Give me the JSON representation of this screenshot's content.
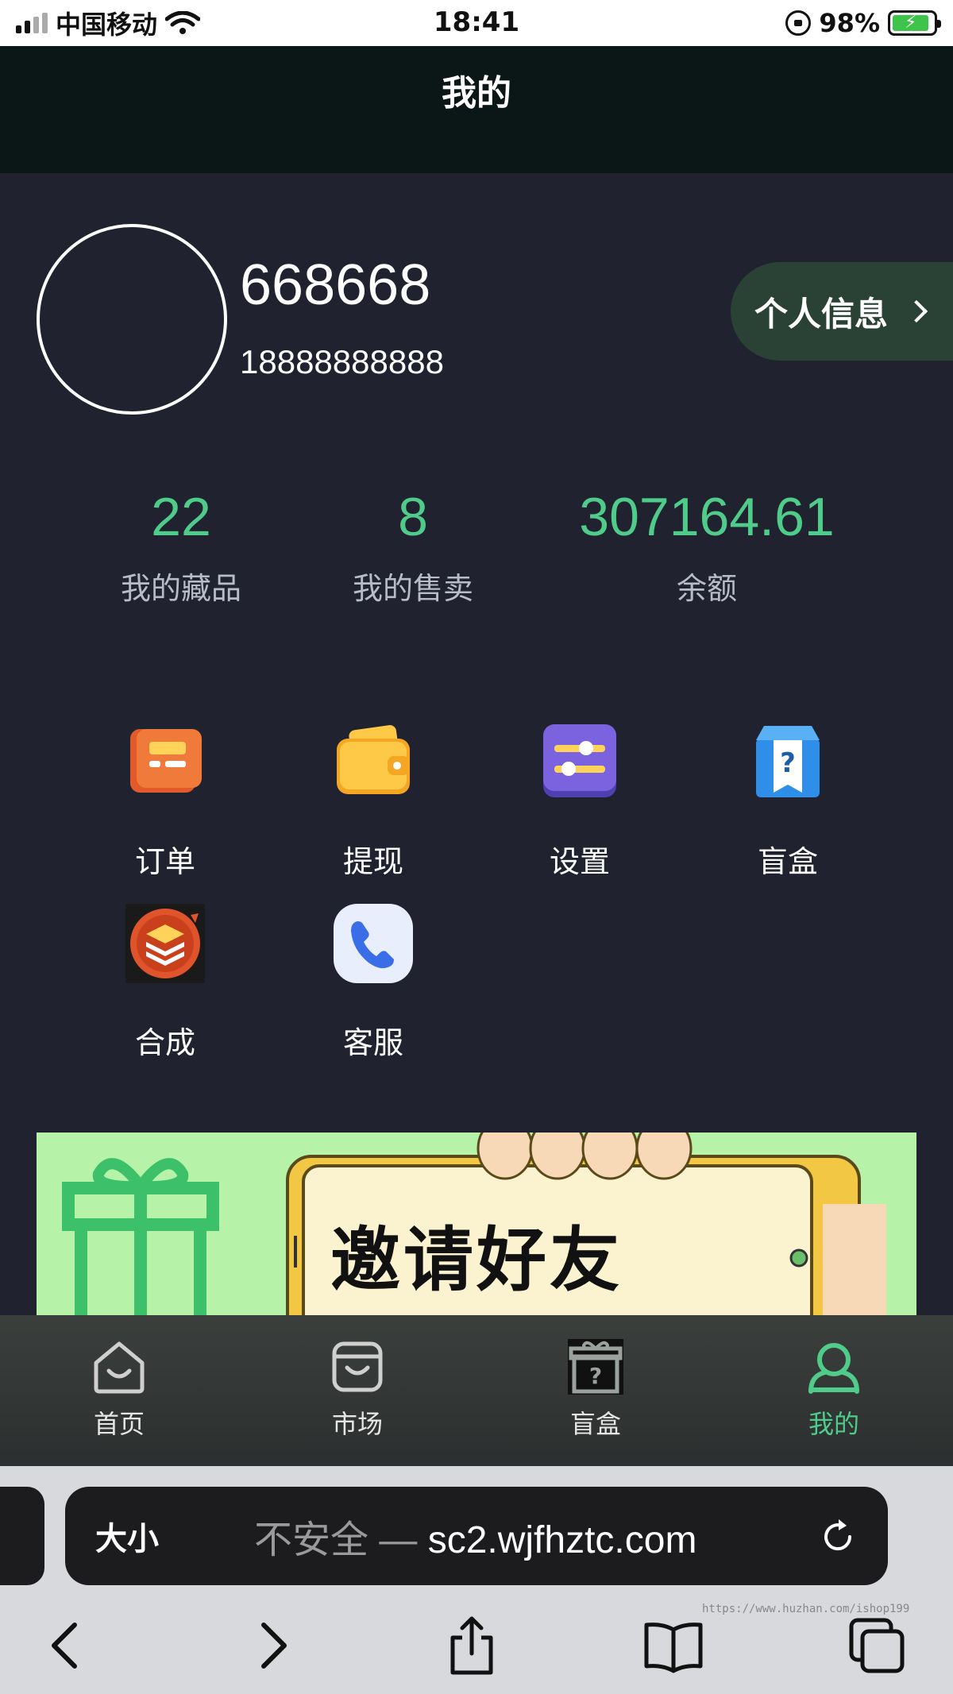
{
  "status_bar": {
    "carrier": "中国移动",
    "time": "18:41",
    "battery_percent": "98%"
  },
  "header": {
    "title": "我的"
  },
  "profile": {
    "username": "668668",
    "phone": "18888888888",
    "info_button_label": "个人信息"
  },
  "stats": [
    {
      "value": "22",
      "label": "我的藏品"
    },
    {
      "value": "8",
      "label": "我的售卖"
    },
    {
      "value": "307164.61",
      "label": "余额"
    }
  ],
  "menu": [
    {
      "label": "订单",
      "icon": "order-icon"
    },
    {
      "label": "提现",
      "icon": "wallet-icon"
    },
    {
      "label": "设置",
      "icon": "settings-icon"
    },
    {
      "label": "盲盒",
      "icon": "blind-box-icon"
    },
    {
      "label": "合成",
      "icon": "synthesis-icon"
    },
    {
      "label": "客服",
      "icon": "phone-icon"
    }
  ],
  "banner": {
    "text": "邀请好友"
  },
  "tabbar": [
    {
      "label": "首页",
      "icon": "home-icon"
    },
    {
      "label": "市场",
      "icon": "market-icon"
    },
    {
      "label": "盲盒",
      "icon": "blind-box-icon"
    },
    {
      "label": "我的",
      "icon": "user-icon",
      "active": true
    }
  ],
  "browser": {
    "text_size_label": "大小",
    "insecure_label": "不安全 —",
    "domain": "sc2.wjfhztc.com"
  },
  "watermark": "https://www.huzhan.com/ishop199",
  "colors": {
    "accent": "#4fcb8a",
    "background": "#20222f",
    "header": "#0a1716"
  }
}
